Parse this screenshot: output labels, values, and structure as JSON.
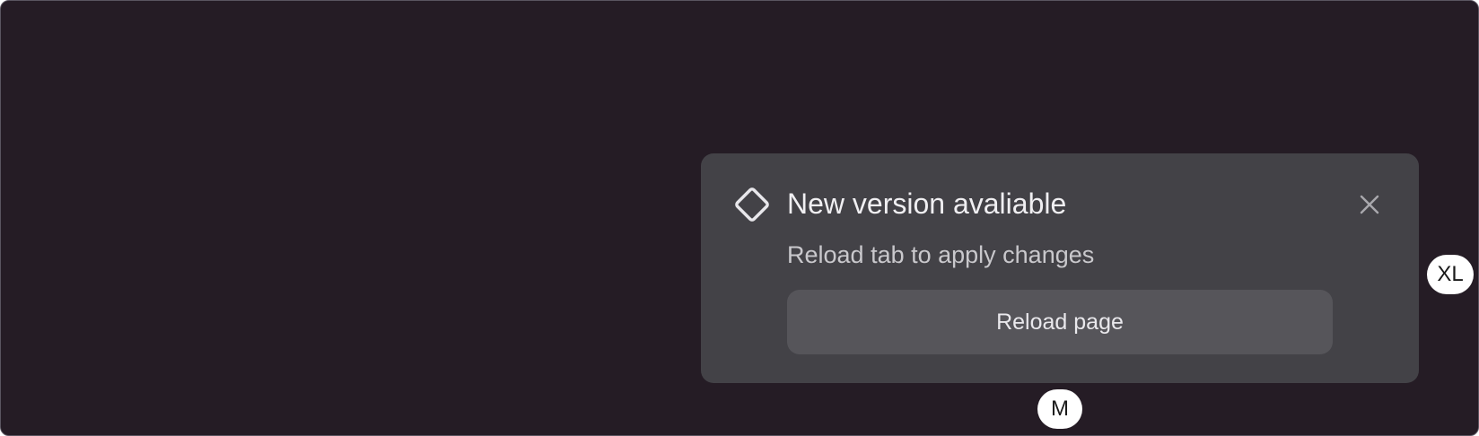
{
  "notification": {
    "icon": "diamond-outline-icon",
    "title": "New version avaliable",
    "subtitle": "Reload tab to apply changes",
    "action_label": "Reload page",
    "close_icon": "close-icon"
  },
  "size_badges": {
    "vertical": "XL",
    "horizontal": "M"
  },
  "colors": {
    "background": "#251c25",
    "toast_background": "#434247",
    "button_background": "#56555a",
    "title_text": "#f0eff2",
    "subtitle_text": "#c9c8cc"
  }
}
